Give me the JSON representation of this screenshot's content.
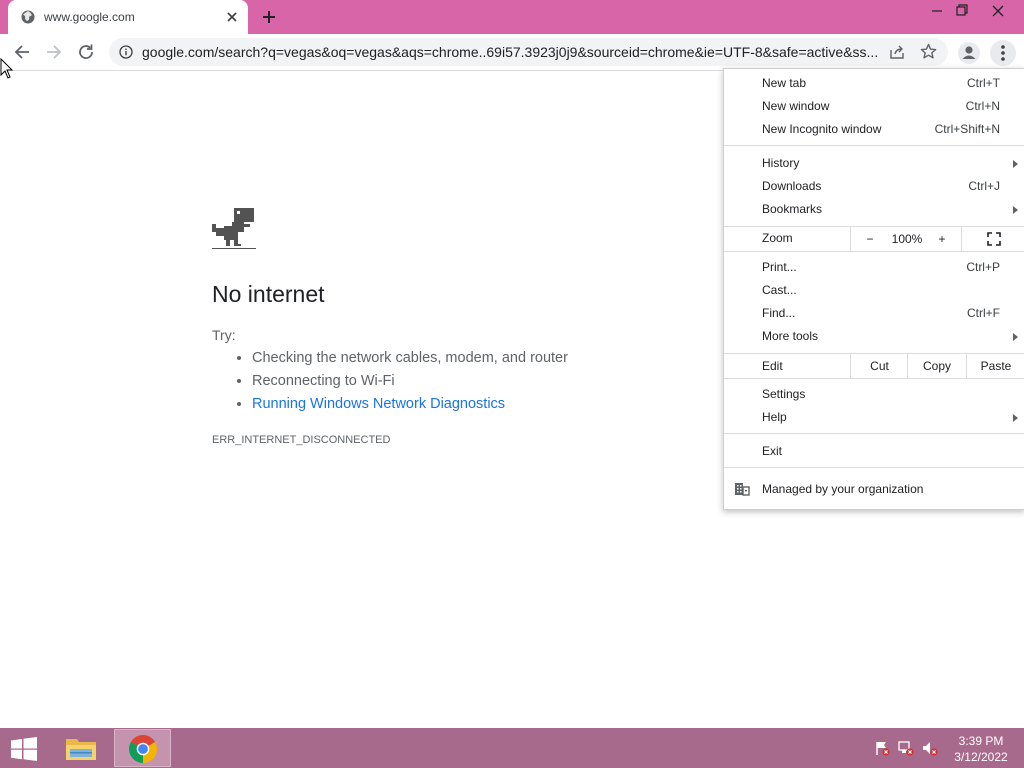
{
  "tab": {
    "title": "www.google.com"
  },
  "omnibox": {
    "url": "google.com/search?q=vegas&oq=vegas&aqs=chrome..69i57.3923j0j9&sourceid=chrome&ie=UTF-8&safe=active&ss..."
  },
  "page": {
    "heading": "No internet",
    "try_label": "Try:",
    "suggestions": [
      "Checking the network cables, modem, and router",
      "Reconnecting to Wi-Fi"
    ],
    "diagnostics_link": "Running Windows Network Diagnostics",
    "error_code": "ERR_INTERNET_DISCONNECTED"
  },
  "menu": {
    "new_tab": {
      "label": "New tab",
      "shortcut": "Ctrl+T"
    },
    "new_window": {
      "label": "New window",
      "shortcut": "Ctrl+N"
    },
    "new_incognito": {
      "label": "New Incognito window",
      "shortcut": "Ctrl+Shift+N"
    },
    "history": {
      "label": "History"
    },
    "downloads": {
      "label": "Downloads",
      "shortcut": "Ctrl+J"
    },
    "bookmarks": {
      "label": "Bookmarks"
    },
    "zoom": {
      "label": "Zoom",
      "minus": "−",
      "value": "100%",
      "plus": "+"
    },
    "print": {
      "label": "Print...",
      "shortcut": "Ctrl+P"
    },
    "cast": {
      "label": "Cast..."
    },
    "find": {
      "label": "Find...",
      "shortcut": "Ctrl+F"
    },
    "more_tools": {
      "label": "More tools"
    },
    "edit": {
      "label": "Edit",
      "cut": "Cut",
      "copy": "Copy",
      "paste": "Paste"
    },
    "settings": {
      "label": "Settings"
    },
    "help": {
      "label": "Help"
    },
    "exit": {
      "label": "Exit"
    },
    "managed": {
      "label": "Managed by your organization"
    }
  },
  "taskbar": {
    "time": "3:39 PM",
    "date": "3/12/2022"
  }
}
